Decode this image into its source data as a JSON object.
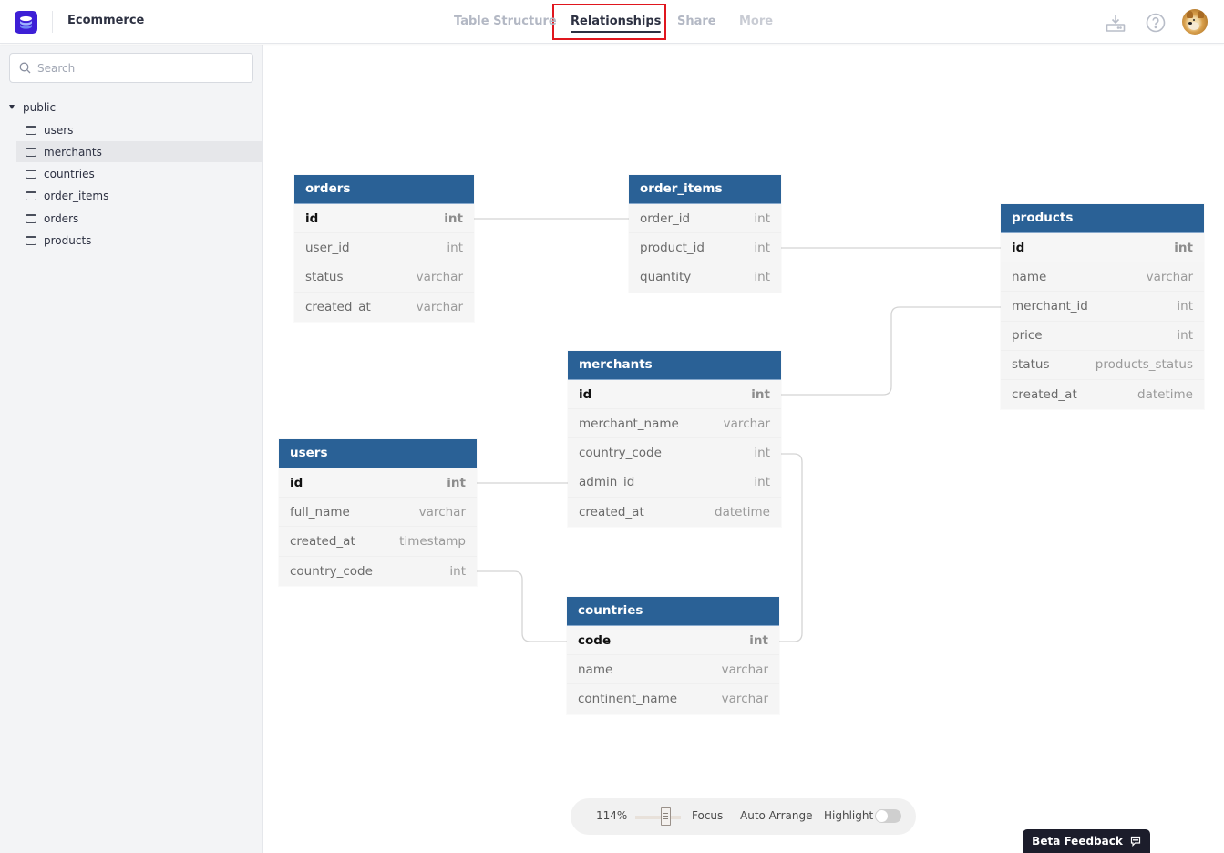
{
  "header": {
    "app_title": "Ecommerce",
    "tabs": [
      {
        "label": "Table Structure",
        "active": false
      },
      {
        "label": "Relationships",
        "active": true
      },
      {
        "label": "Share",
        "active": false
      },
      {
        "label": "More",
        "active": false
      }
    ],
    "icons": [
      "download-icon",
      "help-icon",
      "user-avatar"
    ]
  },
  "sidebar": {
    "search_placeholder": "Search",
    "search_value": "",
    "schema": "public",
    "tables": [
      {
        "label": "users",
        "selected": false
      },
      {
        "label": "merchants",
        "selected": true
      },
      {
        "label": "countries",
        "selected": false
      },
      {
        "label": "order_items",
        "selected": false
      },
      {
        "label": "orders",
        "selected": false
      },
      {
        "label": "products",
        "selected": false
      }
    ]
  },
  "diagram": {
    "tables": {
      "orders": {
        "name": "orders",
        "columns": [
          {
            "name": "id",
            "type": "int",
            "pk": true
          },
          {
            "name": "user_id",
            "type": "int"
          },
          {
            "name": "status",
            "type": "varchar"
          },
          {
            "name": "created_at",
            "type": "varchar"
          }
        ]
      },
      "order_items": {
        "name": "order_items",
        "columns": [
          {
            "name": "order_id",
            "type": "int"
          },
          {
            "name": "product_id",
            "type": "int"
          },
          {
            "name": "quantity",
            "type": "int"
          }
        ]
      },
      "products": {
        "name": "products",
        "columns": [
          {
            "name": "id",
            "type": "int",
            "pk": true
          },
          {
            "name": "name",
            "type": "varchar"
          },
          {
            "name": "merchant_id",
            "type": "int"
          },
          {
            "name": "price",
            "type": "int"
          },
          {
            "name": "status",
            "type": "products_status"
          },
          {
            "name": "created_at",
            "type": "datetime"
          }
        ]
      },
      "merchants": {
        "name": "merchants",
        "columns": [
          {
            "name": "id",
            "type": "int",
            "pk": true
          },
          {
            "name": "merchant_name",
            "type": "varchar"
          },
          {
            "name": "country_code",
            "type": "int"
          },
          {
            "name": "admin_id",
            "type": "int"
          },
          {
            "name": "created_at",
            "type": "datetime"
          }
        ]
      },
      "users": {
        "name": "users",
        "columns": [
          {
            "name": "id",
            "type": "int",
            "pk": true
          },
          {
            "name": "full_name",
            "type": "varchar"
          },
          {
            "name": "created_at",
            "type": "timestamp"
          },
          {
            "name": "country_code",
            "type": "int"
          }
        ]
      },
      "countries": {
        "name": "countries",
        "columns": [
          {
            "name": "code",
            "type": "int",
            "pk": true
          },
          {
            "name": "name",
            "type": "varchar"
          },
          {
            "name": "continent_name",
            "type": "varchar"
          }
        ]
      }
    },
    "relationships": [
      {
        "from": "orders.id",
        "to": "order_items.order_id"
      },
      {
        "from": "order_items.product_id",
        "to": "products.id"
      },
      {
        "from": "merchants.id",
        "to": "products.merchant_id"
      },
      {
        "from": "users.id",
        "to": "merchants.admin_id"
      },
      {
        "from": "users.country_code",
        "to": "countries.code"
      },
      {
        "from": "merchants.country_code",
        "to": "countries.code"
      }
    ]
  },
  "toolbar": {
    "zoom_label": "114%",
    "zoom_percent": 114,
    "focus_label": "Focus",
    "auto_arrange_label": "Auto Arrange",
    "highlight_label": "Highlight",
    "highlight_on": false
  },
  "feedback": {
    "label": "Beta Feedback"
  }
}
